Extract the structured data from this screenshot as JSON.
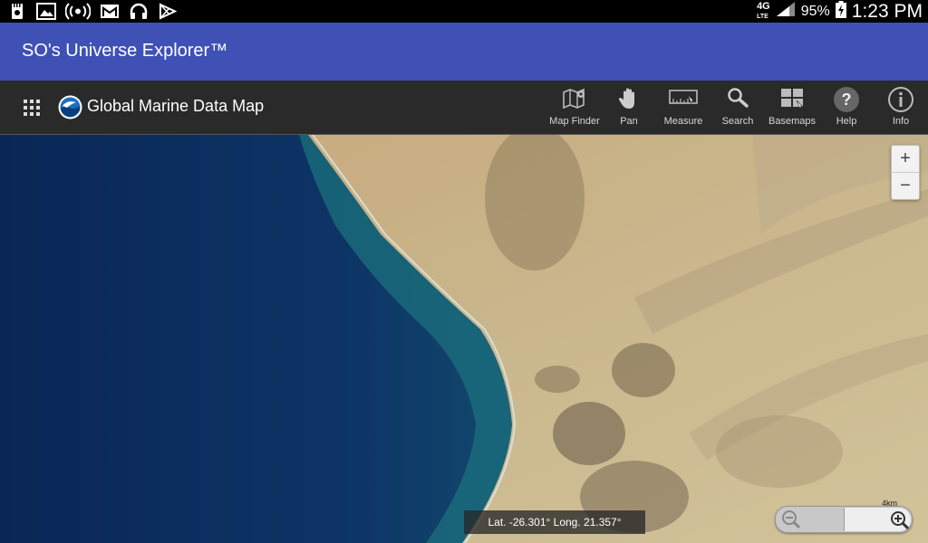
{
  "status_bar": {
    "left_icons": [
      "sd-card-icon",
      "image-icon",
      "broadcast-icon",
      "mail-icon",
      "headphones-icon",
      "play-store-icon"
    ],
    "network": "4G LTE",
    "battery": "95%",
    "time": "1:23 PM"
  },
  "app_bar": {
    "title": "SO's Universe Explorer™"
  },
  "toolbar": {
    "map_title": "Global Marine Data Map",
    "tools": [
      {
        "label": "Map Finder",
        "icon": "map-finder-icon"
      },
      {
        "label": "Pan",
        "icon": "hand-icon"
      },
      {
        "label": "Measure",
        "icon": "ruler-icon"
      },
      {
        "label": "Search",
        "icon": "search-icon"
      },
      {
        "label": "Basemaps",
        "icon": "basemaps-icon"
      },
      {
        "label": "Help",
        "icon": "help-icon"
      },
      {
        "label": "Info",
        "icon": "info-icon"
      }
    ]
  },
  "map": {
    "zoom_in": "+",
    "zoom_out": "−",
    "coordinates": "Lat. -26.301°  Long. 21.357°",
    "scale_label": "4km"
  },
  "colors": {
    "app_bar": "#3f51b5",
    "toolbar": "#2a2a2a",
    "ocean": "#0b2a5c",
    "land": "#c9b48a"
  }
}
